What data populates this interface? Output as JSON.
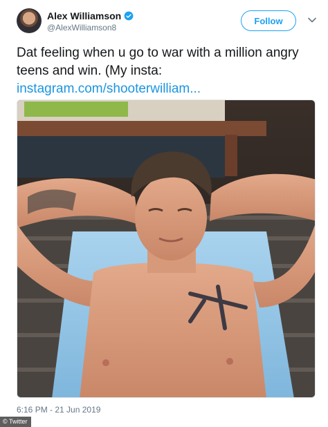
{
  "tweet": {
    "author": {
      "display_name": "Alex Williamson",
      "handle": "@AlexWilliamson8",
      "verified_icon": "verified-badge-icon",
      "avatar_icon": "avatar"
    },
    "follow_label": "Follow",
    "menu_icon": "chevron-down-icon",
    "text": "Dat feeling when u go to war with a million angry teens and win. (My insta: ",
    "link_text": "instagram.com/shooterwilliam...",
    "timestamp": "6:16 PM - 21 Jun 2019"
  },
  "overlay": {
    "credit": "© Twitter"
  },
  "colors": {
    "accent": "#1da1f2",
    "link": "#1b95e0",
    "muted": "#657786"
  }
}
